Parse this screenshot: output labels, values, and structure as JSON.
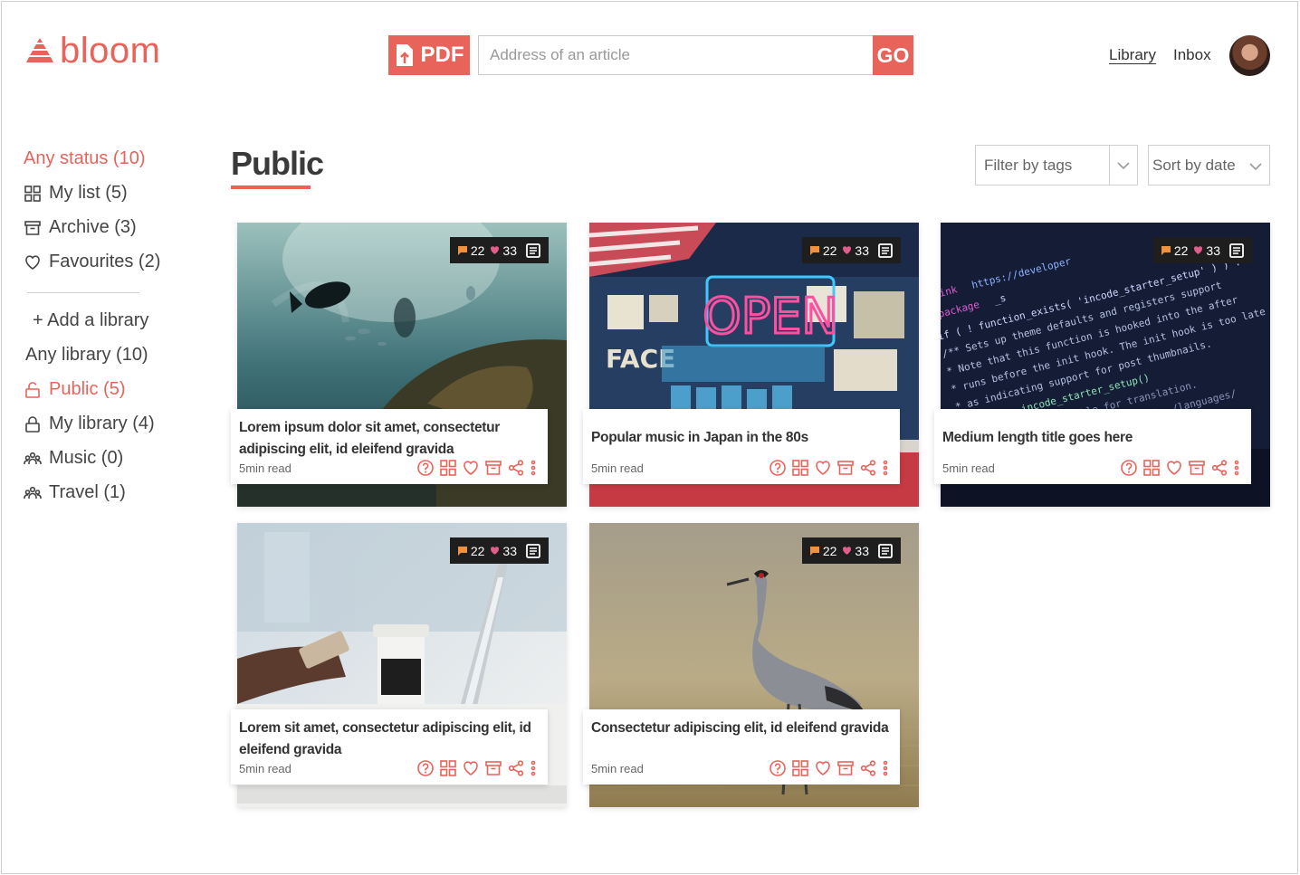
{
  "brand": {
    "name": "bloom",
    "accent": "#e8635a"
  },
  "header": {
    "pdf_label": "PDF",
    "address_placeholder": "Address of an article",
    "address_value": "",
    "go_label": "GO",
    "nav": {
      "library": "Library",
      "inbox": "Inbox"
    }
  },
  "sidebar": {
    "status_items": [
      {
        "label": "Any status (10)",
        "icon": "none",
        "active": true
      },
      {
        "label": "My list (5)",
        "icon": "grid-icon",
        "active": false
      },
      {
        "label": "Archive (3)",
        "icon": "archive-icon",
        "active": false
      },
      {
        "label": "Favourites (2)",
        "icon": "heart-icon",
        "active": false
      }
    ],
    "library_items": [
      {
        "label": "+ Add a library",
        "icon": "none",
        "active": false
      },
      {
        "label": "Any library (10)",
        "icon": "none",
        "active": false
      },
      {
        "label": "Public (5)",
        "icon": "unlock-icon",
        "active": true
      },
      {
        "label": "My library (4)",
        "icon": "lock-icon",
        "active": false
      },
      {
        "label": "Music (0)",
        "icon": "group-icon",
        "active": false
      },
      {
        "label": "Travel (1)",
        "icon": "group-icon",
        "active": false
      }
    ]
  },
  "main": {
    "title": "Public",
    "filter_tags_label": "Filter by tags",
    "sort_label": "Sort by date"
  },
  "cards": [
    {
      "title": "Lorem ipsum dolor sit amet, consectetur adipiscing elit, id eleifend gravida",
      "read": "5min read",
      "comments": "22",
      "likes": "33",
      "image": "underwater-fish"
    },
    {
      "title": "Popular music in Japan in the 80s",
      "read": "5min read",
      "comments": "22",
      "likes": "33",
      "image": "neon-open-sign"
    },
    {
      "title": "Medium length title goes here",
      "read": "5min read",
      "comments": "22",
      "likes": "33",
      "image": "code-screen"
    },
    {
      "title": "Lorem sit amet, consectetur adipiscing elit, id eleifend gravida",
      "read": "5min read",
      "comments": "22",
      "likes": "33",
      "image": "phone-coffee-laptop"
    },
    {
      "title": "Consectetur adipiscing elit, id eleifend gravida",
      "read": "5min read",
      "comments": "22",
      "likes": "33",
      "image": "crane-bird-field"
    }
  ],
  "icons": {
    "actions": [
      "help-icon",
      "grid-icon",
      "heart-icon",
      "archive-icon",
      "share-icon",
      "more-icon"
    ],
    "stats": [
      "comment-icon",
      "heart-icon",
      "document-icon"
    ]
  },
  "colors": {
    "stats_comment": "#f0913d",
    "stats_heart": "#e35d8c",
    "stats_bg": "#1e1e1e"
  }
}
